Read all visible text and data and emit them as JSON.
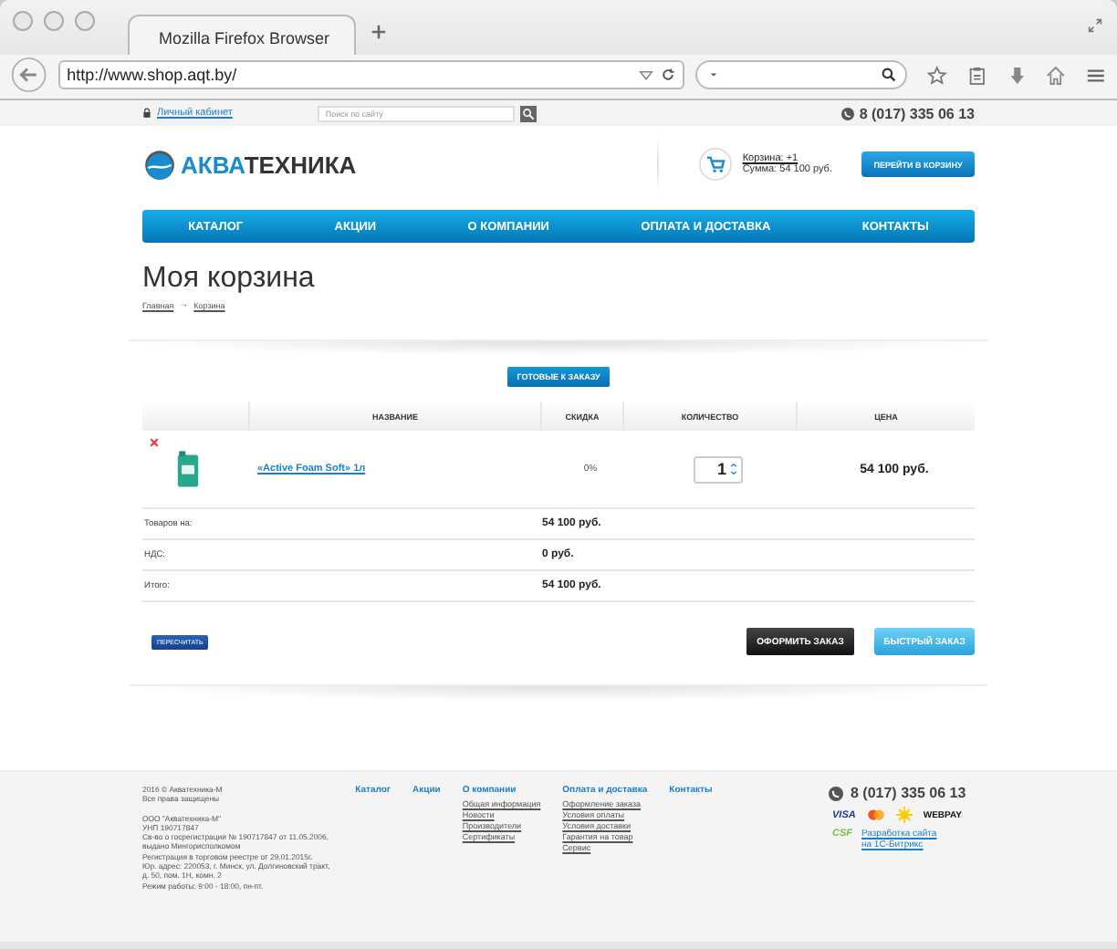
{
  "browser": {
    "tab_title": "Mozilla Firefox Browser",
    "url": "http://www.shop.aqt.by/"
  },
  "topbar": {
    "account_link": "Личный кабинет",
    "search_placeholder": "Поиск по сайту",
    "phone": "8 (017) 335 06 13"
  },
  "header": {
    "logo_accent": "АКВА",
    "logo_rest": "ТЕХНИКА",
    "cart_link": "Корзина: +1",
    "cart_sum": "Сумма: 54 100 руб.",
    "cart_button": "ПЕРЕЙТИ В КОРЗИНУ"
  },
  "nav": [
    "КАТАЛОГ",
    "АКЦИИ",
    "О КОМПАНИИ",
    "ОПЛАТА И ДОСТАВКА",
    "КОНТАКТЫ"
  ],
  "page_title": "Моя корзина",
  "breadcrumbs": [
    "Главная",
    "Корзина"
  ],
  "breadcrumb_separator": "→",
  "tabs": [
    {
      "label": "ГОТОВЫЕ К ЗАКАЗУ",
      "selected": true
    }
  ],
  "table": {
    "columns": [
      "НАЗВАНИЕ",
      "СКИДКА",
      "КОЛИЧЕСТВО",
      "ЦЕНА"
    ],
    "rows": [
      {
        "name": "«Active Foam Soft» 1л",
        "discount": "0%",
        "quantity": "1",
        "price": "54 100 руб."
      }
    ]
  },
  "totals": [
    {
      "label": "Товаров на:",
      "value": "54 100 руб."
    },
    {
      "label": "НДС:",
      "value": "0 руб."
    },
    {
      "label": "Итого:",
      "value": "54 100 руб."
    }
  ],
  "buttons": {
    "recalc": "ПЕРЕСЧИТАТЬ",
    "checkout": "ОФОРМИТЬ ЗАКАЗ",
    "quick": "БЫСТРЫЙ ЗАКАЗ"
  },
  "footer": {
    "info": [
      [
        "2016 © Акватехника-М",
        "Все права защищены"
      ],
      [
        "ООО \"Акватехника-М\"",
        "УНП 190717847",
        "Св-во о госрегистрации № 190717847 от 11.05.2006,",
        "выдано Мингорисполкомом",
        "Регистрация в торговом реестре от 29.01.2015г.",
        "Юр. адрес: 220053, г. Минск, ул. Долгиновский тракт,",
        "д. 50, пом. 1Н, комн. 2",
        "Режим работы: 9:00 - 18:00, пн-пт."
      ]
    ],
    "columns": [
      {
        "title": "Каталог"
      },
      {
        "title": "Акции"
      },
      {
        "title": "О компании",
        "links": [
          "Общая информация",
          "Новости",
          "Производители",
          "Сертификаты"
        ]
      },
      {
        "title": "Оплата и доставка",
        "links": [
          "Оформление заказа",
          "Условия оплаты",
          "Условия доставки",
          "Гарантия на товар",
          "Сервис"
        ]
      },
      {
        "title": "Контакты"
      }
    ],
    "phone": "8 (017) 335 06 13",
    "visa": "VISA",
    "webpay": "WEBPAY",
    "csf": "CSF",
    "dev_link_lines": [
      "Разработка сайта",
      "на 1С-Битрикс"
    ]
  }
}
